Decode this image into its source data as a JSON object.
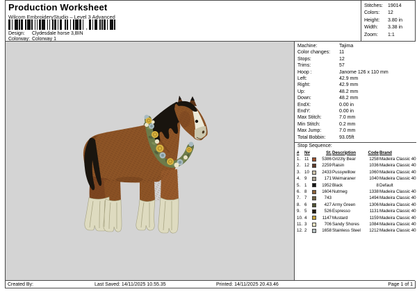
{
  "header": {
    "title": "Production Worksheet",
    "subtitle": "Wilcom EmbroideryStudio – Level 3 Advanced",
    "barcode_icon": "barcode",
    "design_label": "Design:",
    "design_value": "Clydesdale horse 3,BIN",
    "colorway_label": "Colorway:",
    "colorway_value": "Colorway 1"
  },
  "summary": {
    "rows": [
      {
        "label": "Stitches:",
        "value": "19014"
      },
      {
        "label": "Colors:",
        "value": "12"
      },
      {
        "label": "Height:",
        "value": "3.80 in"
      },
      {
        "label": "Width:",
        "value": "3.38 in"
      },
      {
        "label": "Zoom:",
        "value": "1:1"
      }
    ]
  },
  "machine_info": {
    "rows": [
      {
        "label": "Machine:",
        "value": "Tajima"
      },
      {
        "label": "Color changes:",
        "value": "11"
      },
      {
        "label": "Stops:",
        "value": "12"
      },
      {
        "label": "Trims:",
        "value": "57"
      },
      {
        "label": "Hoop :",
        "value": "Janome 126 x 110 mm"
      },
      {
        "label": "Left:",
        "value": "42.9 mm"
      },
      {
        "label": "Right:",
        "value": "42.9 mm"
      },
      {
        "label": "Up:",
        "value": "48.2 mm"
      },
      {
        "label": "Down:",
        "value": "48.2 mm"
      },
      {
        "label": "EndX:",
        "value": "0.00 in"
      },
      {
        "label": "EndY:",
        "value": "0.00 in"
      },
      {
        "label": "Max Stitch:",
        "value": "7.0 mm"
      },
      {
        "label": "Min Stitch:",
        "value": "0.2 mm"
      },
      {
        "label": "Max Jump:",
        "value": "7.0 mm"
      },
      {
        "label": "Total Bobbin:",
        "value": "93.05ft"
      }
    ]
  },
  "stop_sequence": {
    "title": "Stop Sequence:",
    "columns": [
      "#",
      "N#",
      "St.",
      "Description",
      "Code",
      "Brand"
    ],
    "rows": [
      {
        "num": "1.",
        "n": "11",
        "color": "#9b4f2c",
        "st": "5386",
        "description": "Grizzly Bear",
        "code": "1258",
        "brand": "Madeira Classic 40"
      },
      {
        "num": "2.",
        "n": "12",
        "color": "#5f3a28",
        "st": "2259",
        "description": "Raisin",
        "code": "1036",
        "brand": "Madeira Classic 40"
      },
      {
        "num": "3.",
        "n": "10",
        "color": "#cdc3ac",
        "st": "2433",
        "description": "Pussywillow",
        "code": "1060",
        "brand": "Madeira Classic 40"
      },
      {
        "num": "4.",
        "n": "9",
        "color": "#a49c8c",
        "st": "171",
        "description": "Weimaraner",
        "code": "1040",
        "brand": "Madeira Classic 40"
      },
      {
        "num": "5.",
        "n": "1",
        "color": "#141414",
        "st": "1952",
        "description": "Black",
        "code": "8",
        "brand": "Default"
      },
      {
        "num": "6.",
        "n": "8",
        "color": "#8a6038",
        "st": "1604",
        "description": "Nutmeg",
        "code": "1338",
        "brand": "Madeira Classic 40"
      },
      {
        "num": "7.",
        "n": "7",
        "color": "#6f6244",
        "st": "743",
        "description": "",
        "code": "1494",
        "brand": "Madeira Classic 40"
      },
      {
        "num": "8.",
        "n": "6",
        "color": "#4f5233",
        "st": "427",
        "description": "Army Green",
        "code": "1306",
        "brand": "Madeira Classic 40"
      },
      {
        "num": "9.",
        "n": "5",
        "color": "#241c12",
        "st": "526",
        "description": "Espresso",
        "code": "1131",
        "brand": "Madeira Classic 40"
      },
      {
        "num": "10.",
        "n": "4",
        "color": "#c6a23a",
        "st": "1147",
        "description": "Mustard",
        "code": "1159",
        "brand": "Madeira Classic 40"
      },
      {
        "num": "11.",
        "n": "3",
        "color": "#e9e2c2",
        "st": "706",
        "description": "Sandy Shores",
        "code": "1084",
        "brand": "Madeira Classic 40"
      },
      {
        "num": "12.",
        "n": "2",
        "color": "#b4bfbf",
        "st": "1658",
        "description": "Stainless Steel",
        "code": "1212",
        "brand": "Madeira Classic 40"
      }
    ]
  },
  "footer": {
    "created_by": "Created By:",
    "last_saved": "Last Saved: 14/11/2025 10.55.35",
    "printed": "Printed: 14/11/2025 20.43.46",
    "page": "Page 1 of 1"
  }
}
